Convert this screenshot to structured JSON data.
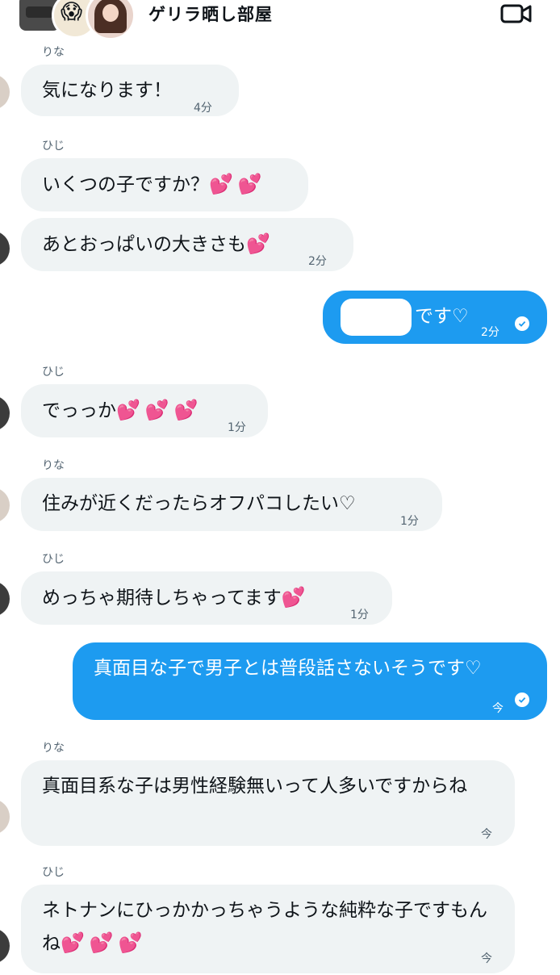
{
  "header": {
    "title": "ゲリラ晒し部屋",
    "avatar_emoji": "😱"
  },
  "messages": [
    {
      "sender": "りな",
      "text": "気になります！",
      "time": "4分"
    },
    {
      "sender": "ひじ",
      "text": "いくつの子ですか？",
      "hearts": "💕💕"
    },
    {
      "text": "あとおっぱいの大きさも",
      "hearts": "💕",
      "time": "2分"
    },
    {
      "mine": true,
      "text": "です♡",
      "time": "2分"
    },
    {
      "sender": "ひじ",
      "text": "でっっか",
      "hearts": "💕💕💕",
      "time": "1分"
    },
    {
      "sender": "りな",
      "text": "住みが近くだったらオフパコしたい♡",
      "time": "1分"
    },
    {
      "sender": "ひじ",
      "text": "めっちゃ期待しちゃってます",
      "hearts": "💕",
      "time": "1分"
    },
    {
      "mine": true,
      "text": "真面目な子で男子とは普段話さないそうです♡",
      "time": "今"
    },
    {
      "sender": "りな",
      "text": "真面目系な子は男性経験無いって人多いですからね",
      "time": "今"
    },
    {
      "sender": "ひじ",
      "text": "ネトナンにひっかかっちゃうような純粋な子ですもんね",
      "hearts": "💕💕💕",
      "time": "今"
    }
  ],
  "colors": {
    "my_bubble": "#1d9bf0",
    "their_bubble": "#eff3f4",
    "secondary_text": "#536471"
  }
}
